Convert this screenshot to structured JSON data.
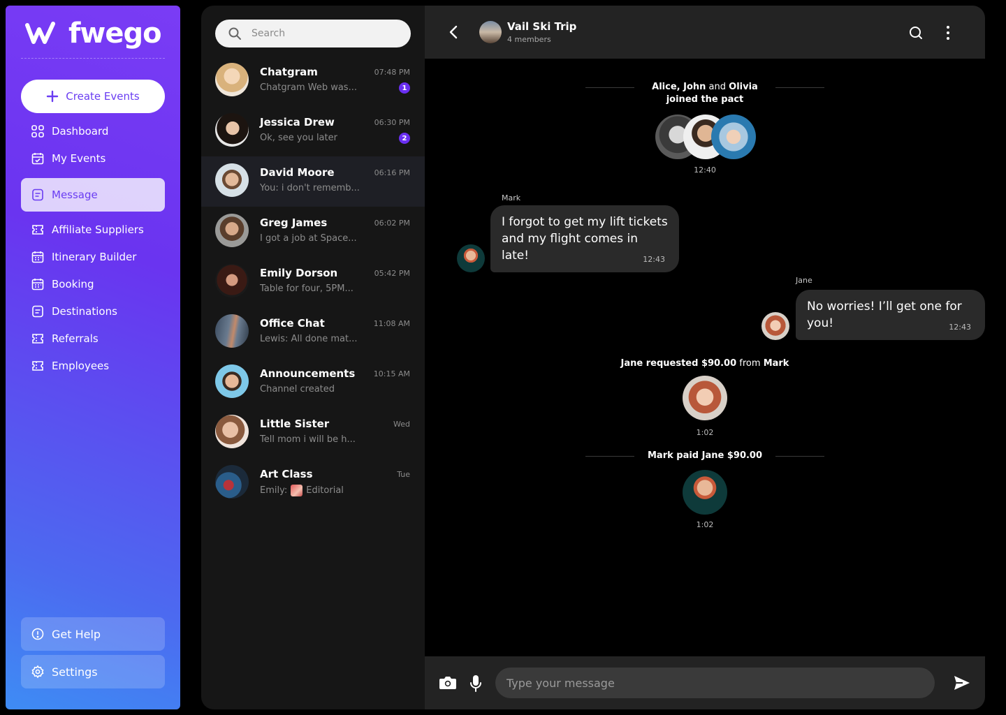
{
  "brand": {
    "name": "fwego"
  },
  "sidebar": {
    "create_label": "Create Events",
    "items": [
      {
        "label": "Dashboard",
        "icon": "grid-icon"
      },
      {
        "label": "My Events",
        "icon": "calendar-check-icon"
      },
      {
        "label": "Message",
        "icon": "message-icon",
        "active": true
      },
      {
        "label": "Affiliate Suppliers",
        "icon": "ticket-icon"
      },
      {
        "label": "Itinerary Builder",
        "icon": "calendar-icon"
      },
      {
        "label": "Booking",
        "icon": "calendar-icon"
      },
      {
        "label": "Destinations",
        "icon": "document-icon"
      },
      {
        "label": "Referrals",
        "icon": "ticket-icon"
      },
      {
        "label": "Employees",
        "icon": "ticket-icon"
      }
    ],
    "help_label": "Get Help",
    "settings_label": "Settings"
  },
  "chatlist": {
    "search_placeholder": "Search",
    "chats": [
      {
        "name": "Chatgram",
        "preview": "Chatgram Web was...",
        "time": "07:48 PM",
        "badge": "1"
      },
      {
        "name": "Jessica Drew",
        "preview": "Ok, see you later",
        "time": "06:30 PM",
        "badge": "2"
      },
      {
        "name": "David Moore",
        "preview": "You: i don't rememb...",
        "time": "06:16 PM",
        "selected": true
      },
      {
        "name": "Greg James",
        "preview": "I got a job at Space...",
        "time": "06:02 PM"
      },
      {
        "name": "Emily Dorson",
        "preview": "Table for four, 5PM...",
        "time": "05:42 PM"
      },
      {
        "name": "Office Chat",
        "preview": "Lewis: All done mat...",
        "time": "11:08 AM"
      },
      {
        "name": "Announcements",
        "preview": "Channel created",
        "time": "10:15 AM"
      },
      {
        "name": "Little Sister",
        "preview": "Tell mom i will be h...",
        "time": "Wed"
      },
      {
        "name": "Art Class",
        "preview_prefix": "Emily:",
        "preview": "Editorial",
        "time": "Tue"
      }
    ]
  },
  "conversation": {
    "title": "Vail Ski Trip",
    "subtitle": "4 members",
    "joined": {
      "n1": "Alice, John",
      "and": "and",
      "n2": "Olivia",
      "line2": "joined the pact",
      "time": "12:40"
    },
    "msg1": {
      "sender": "Mark",
      "text": "I forgot to get my lift tickets and my flight comes in late!",
      "time": "12:43"
    },
    "msg2": {
      "sender": "Jane",
      "text": "No worries! I’ll get one for you!",
      "time": "12:43"
    },
    "request": {
      "part1": "Jane requested $90.00",
      "from": "from",
      "part2": "Mark",
      "time": "1:02"
    },
    "paid": {
      "text": "Mark paid Jane $90.00",
      "time": "1:02"
    },
    "composer_placeholder": "Type your message"
  }
}
